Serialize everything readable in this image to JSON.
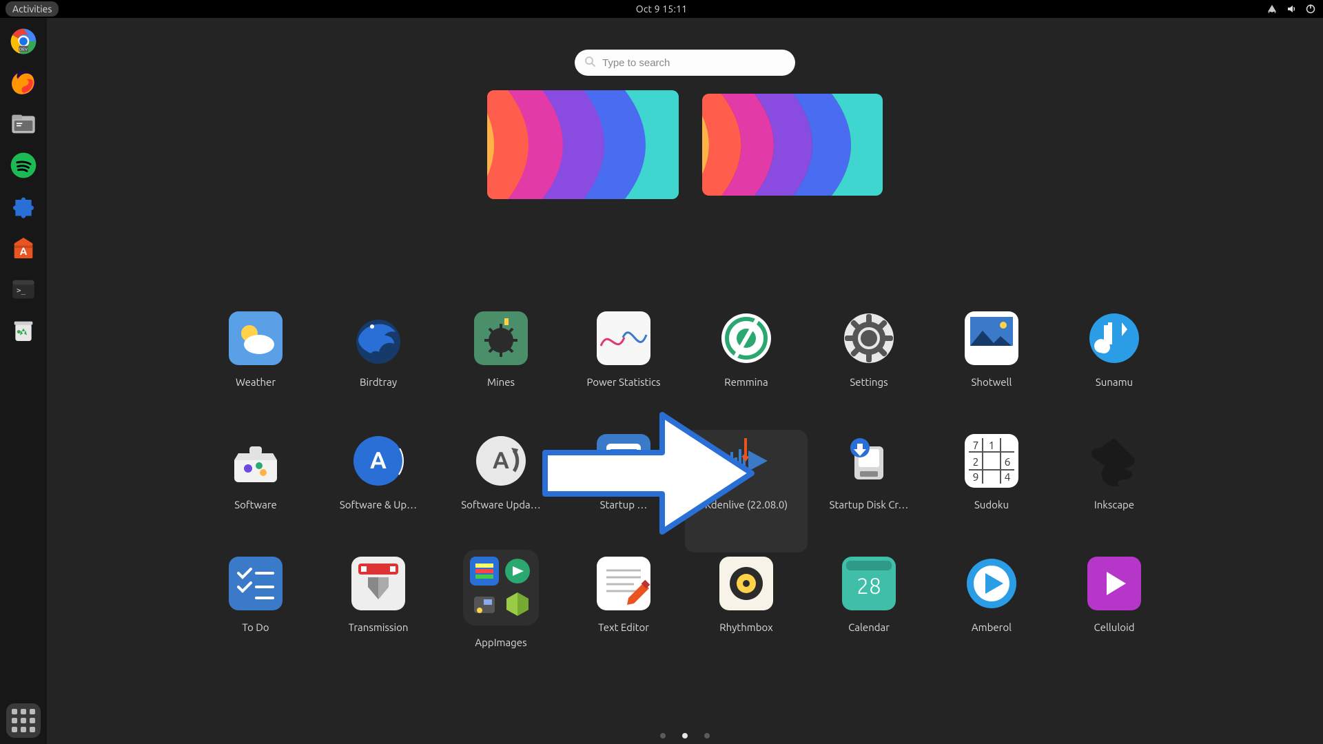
{
  "topbar": {
    "activities_label": "Activities",
    "clock": "Oct 9  15:11"
  },
  "search": {
    "placeholder": "Type to search"
  },
  "dock": {
    "items": [
      "chrome-dev",
      "firefox",
      "files",
      "spotify",
      "puzzle-extension",
      "ubuntu-software",
      "terminal",
      "trash"
    ]
  },
  "workspaces": {
    "count": 2,
    "active_index": 0
  },
  "apps": {
    "rows": [
      [
        {
          "name": "weather",
          "label": "Weather"
        },
        {
          "name": "birdtray",
          "label": "Birdtray"
        },
        {
          "name": "mines",
          "label": "Mines"
        },
        {
          "name": "power-statistics",
          "label": "Power Statistics"
        },
        {
          "name": "remmina",
          "label": "Remmina"
        },
        {
          "name": "settings",
          "label": "Settings"
        },
        {
          "name": "shotwell",
          "label": "Shotwell"
        },
        {
          "name": "sunamu",
          "label": "Sunamu"
        }
      ],
      [
        {
          "name": "software",
          "label": "Software"
        },
        {
          "name": "software-updates",
          "label": "Software & Up…"
        },
        {
          "name": "software-updater",
          "label": "Software Upda…"
        },
        {
          "name": "startup-applications",
          "label": "Startup …"
        },
        {
          "name": "kdenlive",
          "label": "Kdenlive (22.08.0)",
          "highlighted": true
        },
        {
          "name": "startup-disk-creator",
          "label": "Startup Disk Cr…"
        },
        {
          "name": "sudoku",
          "label": "Sudoku"
        },
        {
          "name": "inkscape",
          "label": "Inkscape"
        }
      ],
      [
        {
          "name": "to-do",
          "label": "To Do"
        },
        {
          "name": "transmission",
          "label": "Transmission"
        },
        {
          "name": "appimages",
          "label": "AppImages",
          "folder": true
        },
        {
          "name": "text-editor",
          "label": "Text Editor"
        },
        {
          "name": "rhythmbox",
          "label": "Rhythmbox"
        },
        {
          "name": "calendar",
          "label": "Calendar",
          "extra": "28"
        },
        {
          "name": "amberol",
          "label": "Amberol"
        },
        {
          "name": "celluloid",
          "label": "Celluloid"
        }
      ]
    ]
  },
  "pages": {
    "count": 3,
    "active_index": 1
  },
  "annotation": {
    "target": "kdenlive"
  },
  "colors": {
    "topbar_bg": "#000000",
    "bg": "#242424",
    "accent_blue": "#3a7ac8"
  }
}
